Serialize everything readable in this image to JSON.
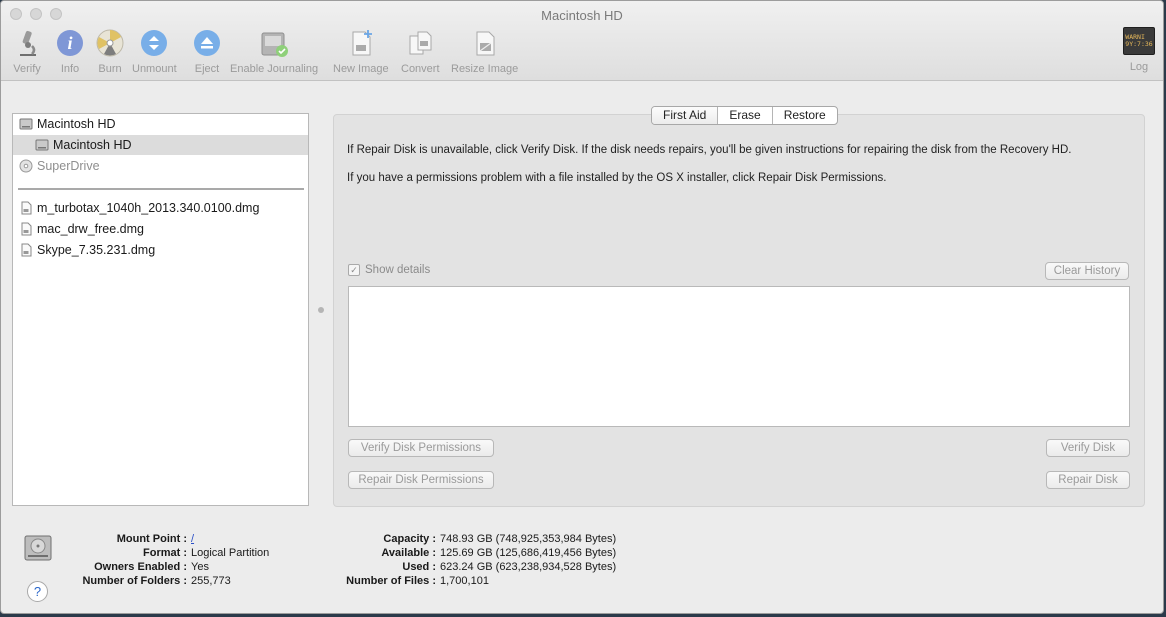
{
  "window": {
    "title": "Macintosh HD"
  },
  "toolbar": {
    "items": [
      {
        "label": "Verify",
        "icon": "microscope-icon"
      },
      {
        "label": "Info",
        "icon": "info-icon"
      },
      {
        "label": "Burn",
        "icon": "burn-icon"
      },
      {
        "label": "Unmount",
        "icon": "unmount-icon"
      },
      {
        "label": "Eject",
        "icon": "eject-icon"
      },
      {
        "label": "Enable Journaling",
        "icon": "journaling-disk-icon"
      },
      {
        "label": "New Image",
        "icon": "new-image-icon"
      },
      {
        "label": "Convert",
        "icon": "convert-icon"
      },
      {
        "label": "Resize Image",
        "icon": "resize-image-icon"
      }
    ],
    "log": {
      "label": "Log",
      "icon_text": "WARNI\n9Y:7:36"
    }
  },
  "sidebar": {
    "items": [
      {
        "label": "Macintosh HD",
        "level": 0,
        "selected": false,
        "dim": false
      },
      {
        "label": "Macintosh HD",
        "level": 1,
        "selected": true,
        "dim": false
      },
      {
        "label": "SuperDrive",
        "level": 0,
        "selected": false,
        "dim": true
      }
    ],
    "images": [
      {
        "label": "m_turbotax_1040h_2013.340.0100.dmg"
      },
      {
        "label": "mac_drw_free.dmg"
      },
      {
        "label": "Skype_7.35.231.dmg"
      }
    ]
  },
  "tabs": [
    {
      "label": "First Aid",
      "active": true
    },
    {
      "label": "Erase",
      "active": false
    },
    {
      "label": "Restore",
      "active": false
    }
  ],
  "first_aid": {
    "line1": "If Repair Disk is unavailable, click Verify Disk. If the disk needs repairs, you'll be given instructions for repairing the disk from the Recovery HD.",
    "line2": "If you have a permissions problem with a file installed by the OS X installer, click Repair Disk Permissions.",
    "show_details": "Show details",
    "clear_history": "Clear History",
    "verify_permissions": "Verify Disk Permissions",
    "verify_disk": "Verify Disk",
    "repair_permissions": "Repair Disk Permissions",
    "repair_disk": "Repair Disk"
  },
  "info": {
    "mount_point_label": "Mount Point :",
    "mount_point": "/",
    "format_label": "Format :",
    "format": "Logical Partition",
    "owners_label": "Owners Enabled :",
    "owners": "Yes",
    "folders_label": "Number of Folders :",
    "folders": "255,773",
    "capacity_label": "Capacity :",
    "capacity": "748.93 GB (748,925,353,984 Bytes)",
    "available_label": "Available :",
    "available": "125.69 GB (125,686,419,456 Bytes)",
    "used_label": "Used :",
    "used": "623.24 GB (623,238,934,528 Bytes)",
    "files_label": "Number of Files :",
    "files": "1,700,101",
    "help": "?"
  }
}
